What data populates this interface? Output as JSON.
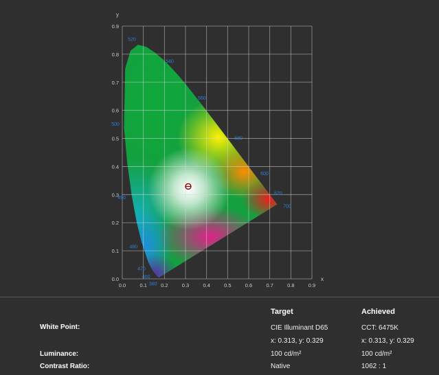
{
  "chart_data": {
    "type": "scatter",
    "xlabel": "x",
    "ylabel": "y",
    "xlim": [
      0,
      0.9
    ],
    "ylim": [
      0,
      0.9
    ],
    "x_ticks": [
      "0.0",
      "0.1",
      "0.2",
      "0.3",
      "0.4",
      "0.5",
      "0.6",
      "0.7",
      "0.8",
      "0.9"
    ],
    "y_ticks": [
      "0.0",
      "0.1",
      "0.2",
      "0.3",
      "0.4",
      "0.5",
      "0.6",
      "0.7",
      "0.8",
      "0.9"
    ],
    "grid": true,
    "locus": [
      [
        0.1741,
        0.005
      ],
      [
        0.1666,
        0.0089
      ],
      [
        0.144,
        0.0297
      ],
      [
        0.1241,
        0.0578
      ],
      [
        0.0913,
        0.1327
      ],
      [
        0.0687,
        0.2007
      ],
      [
        0.0454,
        0.295
      ],
      [
        0.0235,
        0.4127
      ],
      [
        0.0082,
        0.5384
      ],
      [
        0.0139,
        0.7502
      ],
      [
        0.0389,
        0.812
      ],
      [
        0.0743,
        0.8338
      ],
      [
        0.1142,
        0.8262
      ],
      [
        0.1547,
        0.8059
      ],
      [
        0.1929,
        0.7816
      ],
      [
        0.2296,
        0.7543
      ],
      [
        0.2658,
        0.7243
      ],
      [
        0.3016,
        0.6923
      ],
      [
        0.3373,
        0.6589
      ],
      [
        0.3731,
        0.6245
      ],
      [
        0.4087,
        0.5896
      ],
      [
        0.4441,
        0.5547
      ],
      [
        0.4788,
        0.5202
      ],
      [
        0.5125,
        0.4866
      ],
      [
        0.5448,
        0.4544
      ],
      [
        0.5752,
        0.4242
      ],
      [
        0.6029,
        0.3965
      ],
      [
        0.627,
        0.3725
      ],
      [
        0.6482,
        0.3514
      ],
      [
        0.6658,
        0.334
      ],
      [
        0.6801,
        0.3197
      ],
      [
        0.6915,
        0.3083
      ],
      [
        0.7006,
        0.2993
      ],
      [
        0.7079,
        0.292
      ],
      [
        0.7347,
        0.2653
      ]
    ],
    "wavelength_labels": [
      {
        "nm": "380",
        "x": 0.1741,
        "y": 0.005
      },
      {
        "nm": "460",
        "x": 0.144,
        "y": 0.0297
      },
      {
        "nm": "470",
        "x": 0.1241,
        "y": 0.0578
      },
      {
        "nm": "480",
        "x": 0.0913,
        "y": 0.1327
      },
      {
        "nm": "490",
        "x": 0.0454,
        "y": 0.295
      },
      {
        "nm": "500",
        "x": 0.0082,
        "y": 0.5384
      },
      {
        "nm": "520",
        "x": 0.0743,
        "y": 0.8338
      },
      {
        "nm": "540",
        "x": 0.2296,
        "y": 0.7543
      },
      {
        "nm": "560",
        "x": 0.3731,
        "y": 0.6245
      },
      {
        "nm": "580",
        "x": 0.5125,
        "y": 0.4866
      },
      {
        "nm": "600",
        "x": 0.627,
        "y": 0.3725
      },
      {
        "nm": "620",
        "x": 0.6915,
        "y": 0.3083
      },
      {
        "nm": "700",
        "x": 0.7347,
        "y": 0.2653
      }
    ],
    "white_point_marker": {
      "x": 0.313,
      "y": 0.329
    }
  },
  "table": {
    "headers": {
      "target": "Target",
      "achieved": "Achieved"
    },
    "rows": [
      {
        "label": "White Point:",
        "target": "CIE Illuminant D65",
        "achieved": "CCT: 6475K"
      },
      {
        "label": "",
        "target": "x: 0.313, y: 0.329",
        "achieved": "x: 0.313, y: 0.329"
      },
      {
        "label": "Luminance:",
        "target": "100 cd/m²",
        "achieved": "100 cd/m²"
      },
      {
        "label": "Contrast Ratio:",
        "target": "Native",
        "achieved": "1062 : 1"
      }
    ]
  }
}
